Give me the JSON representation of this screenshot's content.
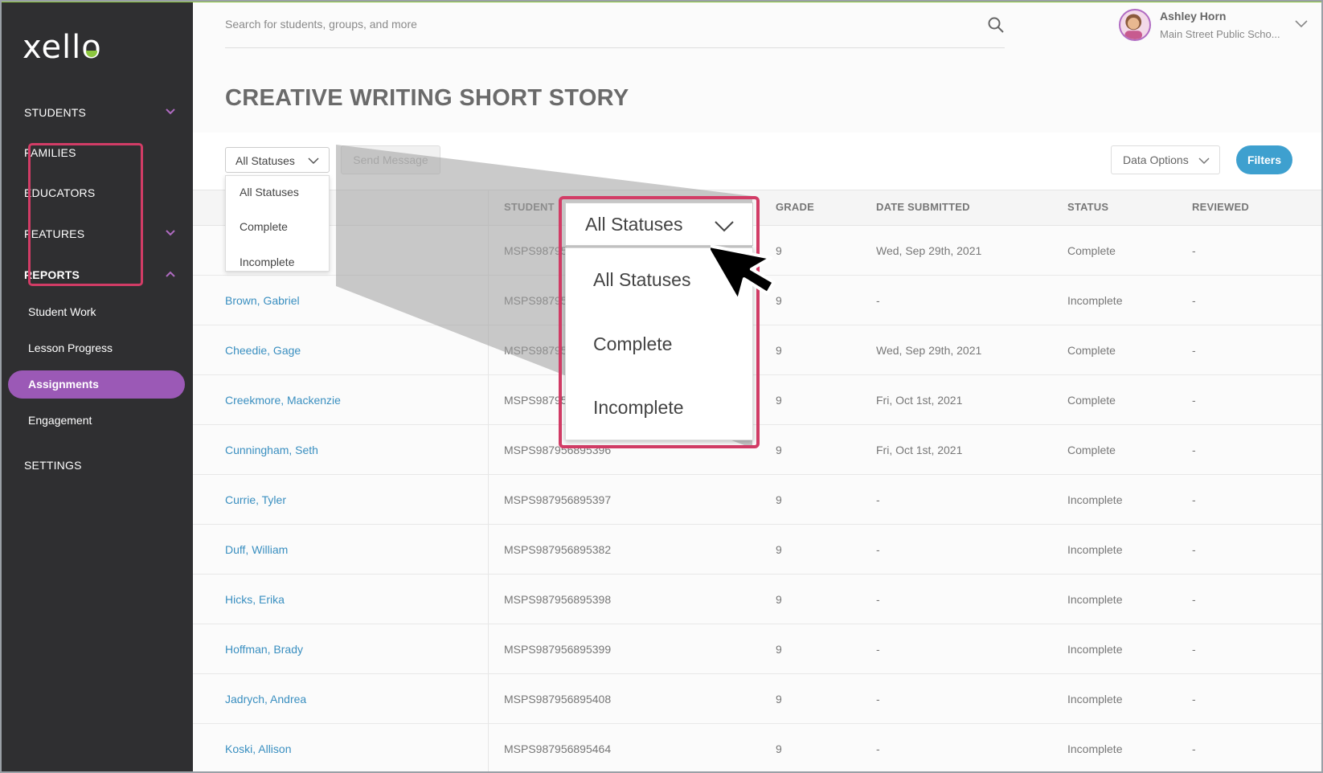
{
  "sidebar": {
    "logo": "xello",
    "items": [
      {
        "label": "STUDENTS"
      },
      {
        "label": "FAMILIES"
      },
      {
        "label": "EDUCATORS"
      },
      {
        "label": "FEATURES"
      },
      {
        "label": "REPORTS"
      },
      {
        "label": "SETTINGS"
      }
    ],
    "reports_sub": [
      {
        "label": "Student Work"
      },
      {
        "label": "Lesson Progress"
      },
      {
        "label": "Assignments"
      },
      {
        "label": "Engagement"
      }
    ],
    "accent_color": "#9b59b6"
  },
  "header": {
    "search_placeholder": "Search for students, groups, and more",
    "user_name": "Ashley Horn",
    "user_school": "Main Street Public Scho..."
  },
  "page_title": "CREATIVE WRITING SHORT STORY",
  "toolbar": {
    "status_select_value": "All Statuses",
    "send_message_label": "Send Message",
    "data_options_label": "Data Options",
    "filters_label": "Filters"
  },
  "status_options": [
    "All Statuses",
    "Complete",
    "Incomplete"
  ],
  "zoom_callout": {
    "select_value": "All Statuses",
    "options": [
      "All Statuses",
      "Complete",
      "Incomplete"
    ],
    "highlight_color": "#d23c66"
  },
  "table": {
    "columns": {
      "student_id": "STUDENT",
      "grade": "GRADE",
      "date_submitted": "DATE SUBMITTED",
      "status": "STATUS",
      "reviewed": "REVIEWED"
    },
    "rows": [
      {
        "name": "",
        "sid": "MSPS98795",
        "grade": "9",
        "date": "Wed, Sep 29th, 2021",
        "status": "Complete",
        "reviewed": "-"
      },
      {
        "name": "Brown, Gabriel",
        "sid": "MSPS98795",
        "grade": "9",
        "date": "-",
        "status": "Incomplete",
        "reviewed": "-"
      },
      {
        "name": "Cheedie, Gage",
        "sid": "MSPS98795",
        "grade": "9",
        "date": "Wed, Sep 29th, 2021",
        "status": "Complete",
        "reviewed": "-"
      },
      {
        "name": "Creekmore, Mackenzie",
        "sid": "MSPS98795",
        "grade": "9",
        "date": "Fri, Oct 1st, 2021",
        "status": "Complete",
        "reviewed": "-"
      },
      {
        "name": "Cunningham, Seth",
        "sid": "MSPS987956895396",
        "grade": "9",
        "date": "Fri, Oct 1st, 2021",
        "status": "Complete",
        "reviewed": "-"
      },
      {
        "name": "Currie, Tyler",
        "sid": "MSPS987956895397",
        "grade": "9",
        "date": "-",
        "status": "Incomplete",
        "reviewed": "-"
      },
      {
        "name": "Duff, William",
        "sid": "MSPS987956895382",
        "grade": "9",
        "date": "-",
        "status": "Incomplete",
        "reviewed": "-"
      },
      {
        "name": "Hicks, Erika",
        "sid": "MSPS987956895398",
        "grade": "9",
        "date": "-",
        "status": "Incomplete",
        "reviewed": "-"
      },
      {
        "name": "Hoffman, Brady",
        "sid": "MSPS987956895399",
        "grade": "9",
        "date": "-",
        "status": "Incomplete",
        "reviewed": "-"
      },
      {
        "name": "Jadrych, Andrea",
        "sid": "MSPS987956895408",
        "grade": "9",
        "date": "-",
        "status": "Incomplete",
        "reviewed": "-"
      },
      {
        "name": "Koski, Allison",
        "sid": "MSPS987956895464",
        "grade": "9",
        "date": "-",
        "status": "Incomplete",
        "reviewed": "-"
      }
    ]
  }
}
